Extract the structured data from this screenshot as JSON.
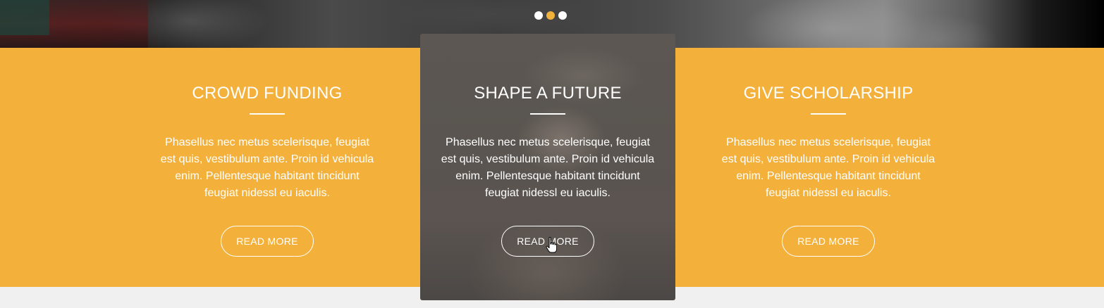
{
  "slider": {
    "dots": [
      {
        "label": "slide-1",
        "active": false
      },
      {
        "label": "slide-2",
        "active": true
      },
      {
        "label": "slide-3",
        "active": false
      }
    ]
  },
  "colors": {
    "accent": "#f3b13c",
    "active_dot": "#f1b13b",
    "text": "#ffffff",
    "footer_bg": "#f0f0f0"
  },
  "cards": [
    {
      "title": "CROWD FUNDING",
      "text": "Phasellus nec metus scelerisque, feugiat est quis, vestibulum ante. Proin id vehicula enim. Pellentesque habitant tincidunt feugiat nidessl eu iaculis.",
      "button": "READ MORE"
    },
    {
      "title": "SHAPE A FUTURE",
      "text": "Phasellus nec metus scelerisque, feugiat est quis, vestibulum ante. Proin id vehicula enim. Pellentesque habitant tincidunt feugiat nidessl eu iaculis.",
      "button": "READ MORE",
      "hovered": true
    },
    {
      "title": "GIVE SCHOLARSHIP",
      "text": "Phasellus nec metus scelerisque, feugiat est quis, vestibulum ante. Proin id vehicula enim. Pellentesque habitant tincidunt feugiat nidessl eu iaculis.",
      "button": "READ MORE"
    }
  ],
  "cursor_icon": "hand-pointer-icon"
}
